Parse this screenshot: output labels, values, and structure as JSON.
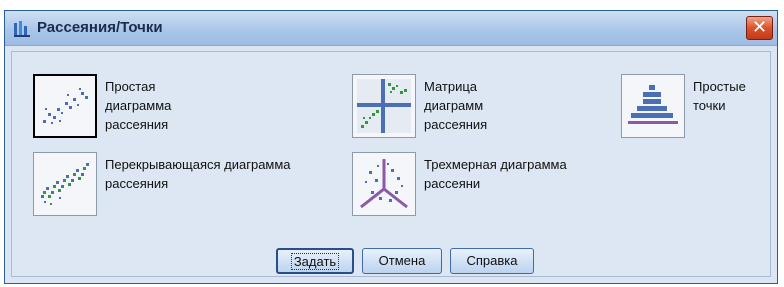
{
  "window": {
    "title": "Рассеяния/Точки",
    "close_glyph": "✕"
  },
  "options": {
    "simple": {
      "lines": [
        "Простая",
        "диаграмма",
        "рассеяния"
      ],
      "icon": "simple-scatter-icon",
      "selected": true
    },
    "matrix": {
      "lines": [
        "Матрица",
        "диаграмм",
        "рассеяния"
      ],
      "icon": "scatter-matrix-icon"
    },
    "dot": {
      "lines": [
        "Простые",
        "точки"
      ],
      "icon": "simple-dot-icon"
    },
    "overlay": {
      "lines": [
        "Перекрывающаяся диаграмма",
        "рассеяния"
      ],
      "icon": "overlay-scatter-icon"
    },
    "three_d": {
      "lines": [
        "Трехмерная диаграмма",
        "рассеяни"
      ],
      "icon": "3d-scatter-icon"
    }
  },
  "buttons": {
    "define": "Задать",
    "cancel": "Отмена",
    "help": "Справка"
  },
  "colors": {
    "accent": "#3f6aa5",
    "dots_blue": "#4a6fb4",
    "dots_green": "#2f9a3a",
    "purple": "#8a5aa8"
  }
}
